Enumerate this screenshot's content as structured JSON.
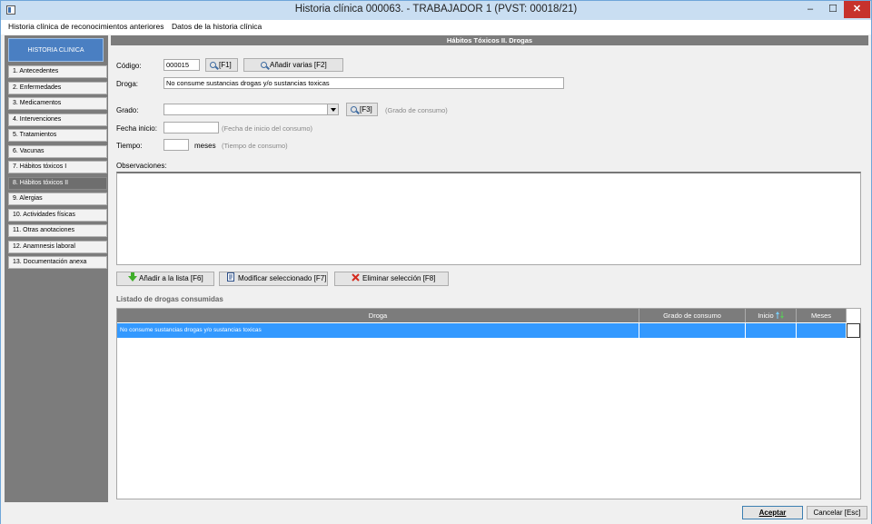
{
  "window": {
    "title": "Historia clínica 000063.   - TRABAJADOR 1   (PVST: 00018/21)",
    "minimize": "–",
    "maximize": "☐",
    "close": "✕"
  },
  "menu": [
    "Historia clínica de reconocimientos anteriores",
    "Datos de la historia clínica"
  ],
  "sidebar": {
    "header": "HISTORIA CLINICA",
    "items": [
      "1. Antecedentes",
      "2. Enfermedades",
      "3. Medicamentos",
      "4. Intervenciones",
      "5. Tratamientos",
      "6. Vacunas",
      "7. Hábitos tóxicos I",
      "8. Hábitos tóxicos II",
      "9. Alergias",
      "10. Actividades físicas",
      "11. Otras anotaciones",
      "12. Anamnesis laboral",
      "13. Documentación anexa"
    ],
    "active_index": 7
  },
  "form": {
    "section_title": "Hábitos Tóxicos II. Drogas",
    "codigo_label": "Código:",
    "codigo_value": "000015",
    "f1_label": "[F1]",
    "anadir_varias_label": "Añadir varias  [F2]",
    "droga_label": "Droga:",
    "droga_value": "No consume sustancias drogas y/o sustancias toxicas",
    "grado_label": "Grado:",
    "grado_value": "",
    "f3_label": "[F3]",
    "grado_hint": "(Grado de consumo)",
    "fecha_label": "Fecha inicio:",
    "fecha_value": "",
    "fecha_hint": "(Fecha de inicio del consumo)",
    "tiempo_label": "Tiempo:",
    "tiempo_value": "",
    "meses_label": "meses",
    "tiempo_hint": "(Tiempo de consumo)",
    "observaciones_label": "Observaciones:",
    "observaciones_value": ""
  },
  "actions": {
    "add": "Añadir a la lista  [F6]",
    "modify": "Modificar seleccionado  [F7]",
    "delete": "Eliminar selección  [F8]"
  },
  "list": {
    "title": "Listado de drogas consumidas",
    "columns": [
      "Droga",
      "Grado de consumo",
      "Inicio",
      "Meses"
    ],
    "rows": [
      [
        "No consume sustancias drogas y/o sustancias toxicas",
        "",
        "",
        ""
      ]
    ]
  },
  "footer": {
    "accept": "Aceptar",
    "cancel": "Cancelar [Esc]"
  },
  "colors": {
    "selection": "#3399ff",
    "sidebar_header": "#4a7fc2",
    "close_button": "#c7322c",
    "section_header": "#7c7c7c"
  }
}
